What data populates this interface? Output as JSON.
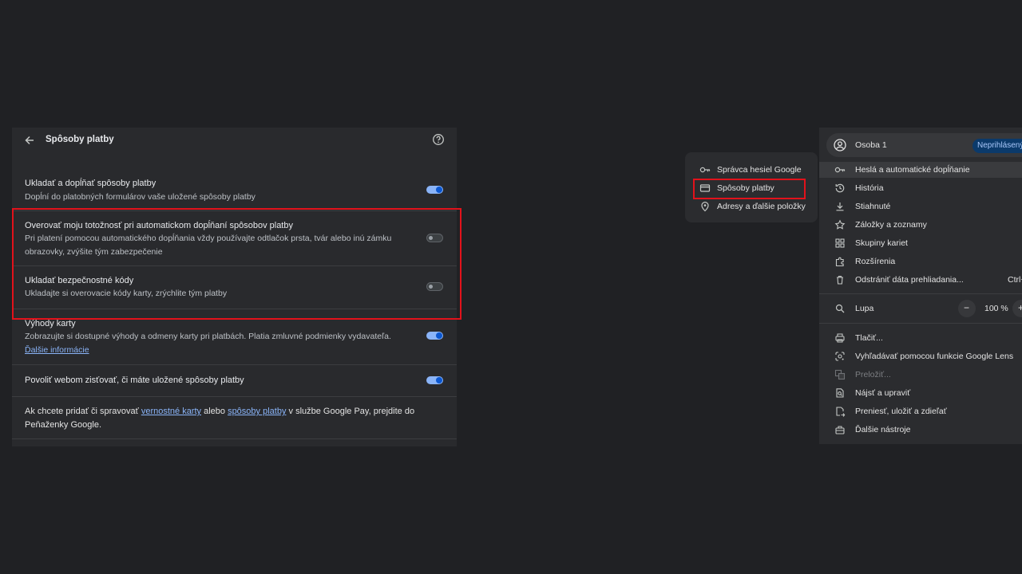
{
  "settings": {
    "title": "Spôsoby platby",
    "rows": [
      {
        "title": "Ukladať a dopĺňať spôsoby platby",
        "desc": "Dopĺní do platobných formulárov vaše uložené spôsoby platby",
        "toggle": "on"
      },
      {
        "title": "Overovať moju totožnosť pri automatickom dopĺňaní spôsobov platby",
        "desc": "Pri platení pomocou automatického dopĺňania vždy používajte odtlačok prsta, tvár alebo inú zámku obrazovky, zvýšite tým zabezpečenie",
        "toggle": "off"
      },
      {
        "title": "Ukladať bezpečnostné kódy",
        "desc": "Ukladajte si overovacie kódy karty, zrýchlite tým platby",
        "toggle": "off"
      },
      {
        "title": "Výhody karty",
        "desc": "Zobrazujte si dostupné výhody a odmeny karty pri platbách. Platia zmluvné podmienky vydavateľa.",
        "link": "Ďalšie informácie",
        "toggle": "on"
      },
      {
        "title": "Povoliť webom zisťovať, či máte uložené spôsoby platby",
        "toggle": "on"
      }
    ],
    "footer": {
      "before": "Ak chcete pridať či spravovať ",
      "link1": "vernostné karty",
      "middle": " alebo ",
      "link2": "spôsoby platby",
      "after": " v službe Google Pay, prejdite do Peňaženky Google."
    }
  },
  "submenu": {
    "items": [
      {
        "label": "Správca hesiel Google",
        "icon": "key-icon"
      },
      {
        "label": "Spôsoby platby",
        "icon": "credit-card-icon"
      },
      {
        "label": "Adresy a ďalšie položky",
        "icon": "location-pin-icon"
      }
    ]
  },
  "menu": {
    "profile_name": "Osoba 1",
    "profile_status": "Neprihlásený",
    "items_a": [
      {
        "label": "Heslá a automatické dopĺňanie",
        "icon": "key-icon"
      },
      {
        "label": "História",
        "icon": "history-icon"
      },
      {
        "label": "Stiahnuté",
        "icon": "download-icon"
      },
      {
        "label": "Záložky a zoznamy",
        "icon": "star-icon"
      },
      {
        "label": "Skupiny kariet",
        "icon": "tab-groups-icon"
      },
      {
        "label": "Rozšírenia",
        "icon": "extensions-icon"
      },
      {
        "label": "Odstrániť dáta prehliadania...",
        "icon": "trash-icon",
        "shortcut": "Ctrl+"
      }
    ],
    "zoom": {
      "label": "Lupa",
      "value": "100 %",
      "minus": "−",
      "plus": "+"
    },
    "items_b": [
      {
        "label": "Tlačiť...",
        "icon": "print-icon"
      },
      {
        "label": "Vyhľadávať pomocou funkcie Google Lens",
        "icon": "lens-icon"
      },
      {
        "label": "Preložiť...",
        "icon": "translate-icon",
        "disabled": true
      },
      {
        "label": "Nájsť a upraviť",
        "icon": "find-icon"
      },
      {
        "label": "Preniesť, uložiť a zdieľať",
        "icon": "share-icon"
      },
      {
        "label": "Ďalšie nástroje",
        "icon": "toolbox-icon"
      }
    ]
  }
}
